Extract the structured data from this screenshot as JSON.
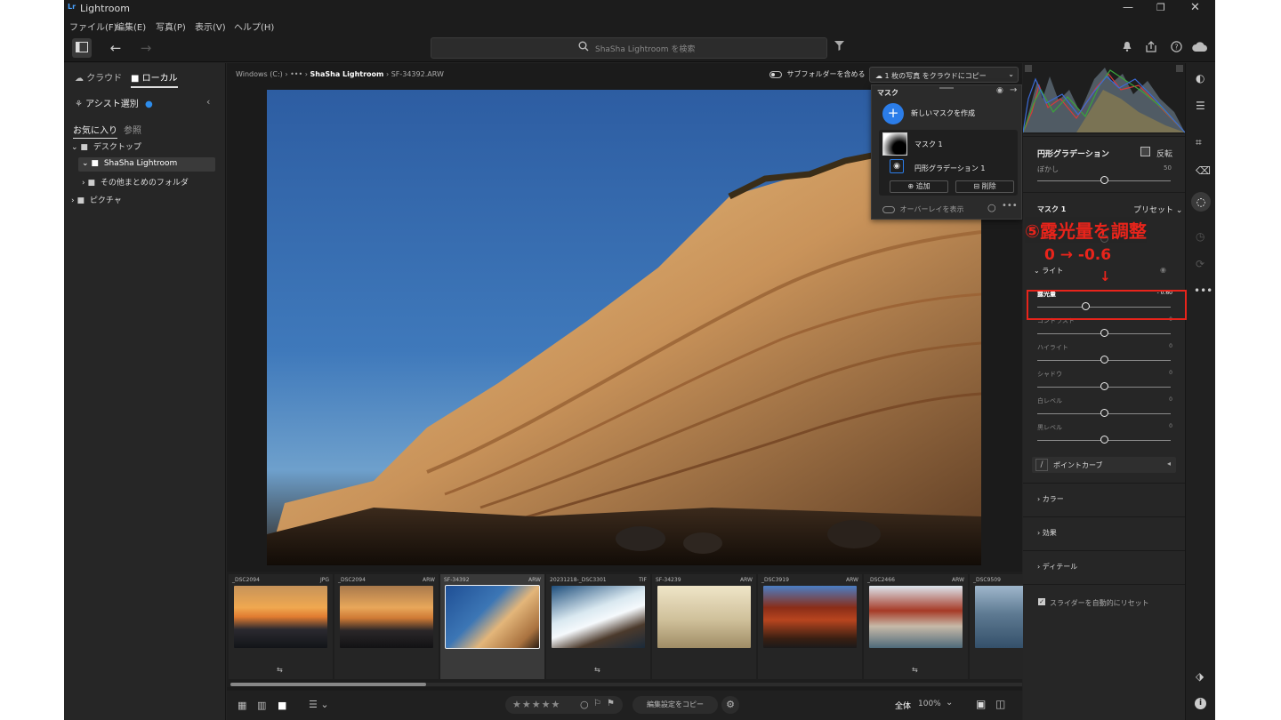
{
  "window": {
    "app_title": "Lightroom",
    "logo": "Lr"
  },
  "menu": [
    "ファイル(F)",
    "編集(E)",
    "写真(P)",
    "表示(V)",
    "ヘルプ(H)"
  ],
  "search": {
    "placeholder": "ShaSha Lightroom を検索"
  },
  "left": {
    "tab_cloud": "クラウド",
    "tab_local": "ローカル",
    "assist": "アシスト選別",
    "fav_tab": "お気に入り",
    "browse_tab": "参照",
    "tree": [
      {
        "label": "デスクトップ"
      },
      {
        "label": "ShaSha Lightroom"
      },
      {
        "label": "その他まとめのフォルダ"
      },
      {
        "label": "ピクチャ"
      }
    ]
  },
  "breadcrumb": {
    "drive": "Windows (C:)",
    "ellipsis": "•••",
    "folder": "ShaSha Lightroom",
    "file": "SF-34392.ARW"
  },
  "subfolders": "サブフォルダーを含める",
  "copy_cloud": "1 枚の写真 をクラウドにコピー",
  "mask_panel": {
    "title": "マスク",
    "new_mask": "新しいマスクを作成",
    "mask_name": "マスク 1",
    "component": "円形グラデーション 1",
    "add": "追加",
    "delete": "削除",
    "overlay": "オーバーレイを表示"
  },
  "right": {
    "radial_title": "円形グラデーション",
    "invert": "反転",
    "feather_label": "ぼかし",
    "feather_value": "50",
    "mask_label": "マスク 1",
    "preset": "プリセット",
    "light": "ライト",
    "sliders": [
      {
        "label": "露光量",
        "value": "- 0.60",
        "pos": 0.36
      },
      {
        "label": "コントラスト",
        "value": "0",
        "pos": 0.5
      },
      {
        "label": "ハイライト",
        "value": "0",
        "pos": 0.5
      },
      {
        "label": "シャドウ",
        "value": "0",
        "pos": 0.5
      },
      {
        "label": "白レベル",
        "value": "0",
        "pos": 0.5
      },
      {
        "label": "黒レベル",
        "value": "0",
        "pos": 0.5
      }
    ],
    "point_curve": "ポイントカーブ",
    "color": "カラー",
    "effects": "効果",
    "detail": "ディテール",
    "auto_reset": "スライダーを自動的にリセット"
  },
  "annotation": {
    "line1": "⑤露光量を調整",
    "line2": "0 → -0.6",
    "arrow": "↓"
  },
  "filmstrip": [
    {
      "name": "_DSC2094",
      "ext": "JPG",
      "badge": "⇆"
    },
    {
      "name": "_DSC2094",
      "ext": "ARW",
      "badge": ""
    },
    {
      "name": "SF-34392",
      "ext": "ARW",
      "badge": ""
    },
    {
      "name": "20231218-_DSC3301",
      "ext": "TIF",
      "badge": "⇆"
    },
    {
      "name": "SF-34239",
      "ext": "ARW",
      "badge": ""
    },
    {
      "name": "_DSC3919",
      "ext": "ARW",
      "badge": ""
    },
    {
      "name": "_DSC2466",
      "ext": "ARW",
      "badge": "⇆"
    },
    {
      "name": "_DSC9509",
      "ext": "",
      "badge": ""
    }
  ],
  "bottom": {
    "stars": "★★★★★",
    "copy_settings": "編集設定をコピー",
    "zoom_fit": "全体",
    "zoom": "100%"
  }
}
